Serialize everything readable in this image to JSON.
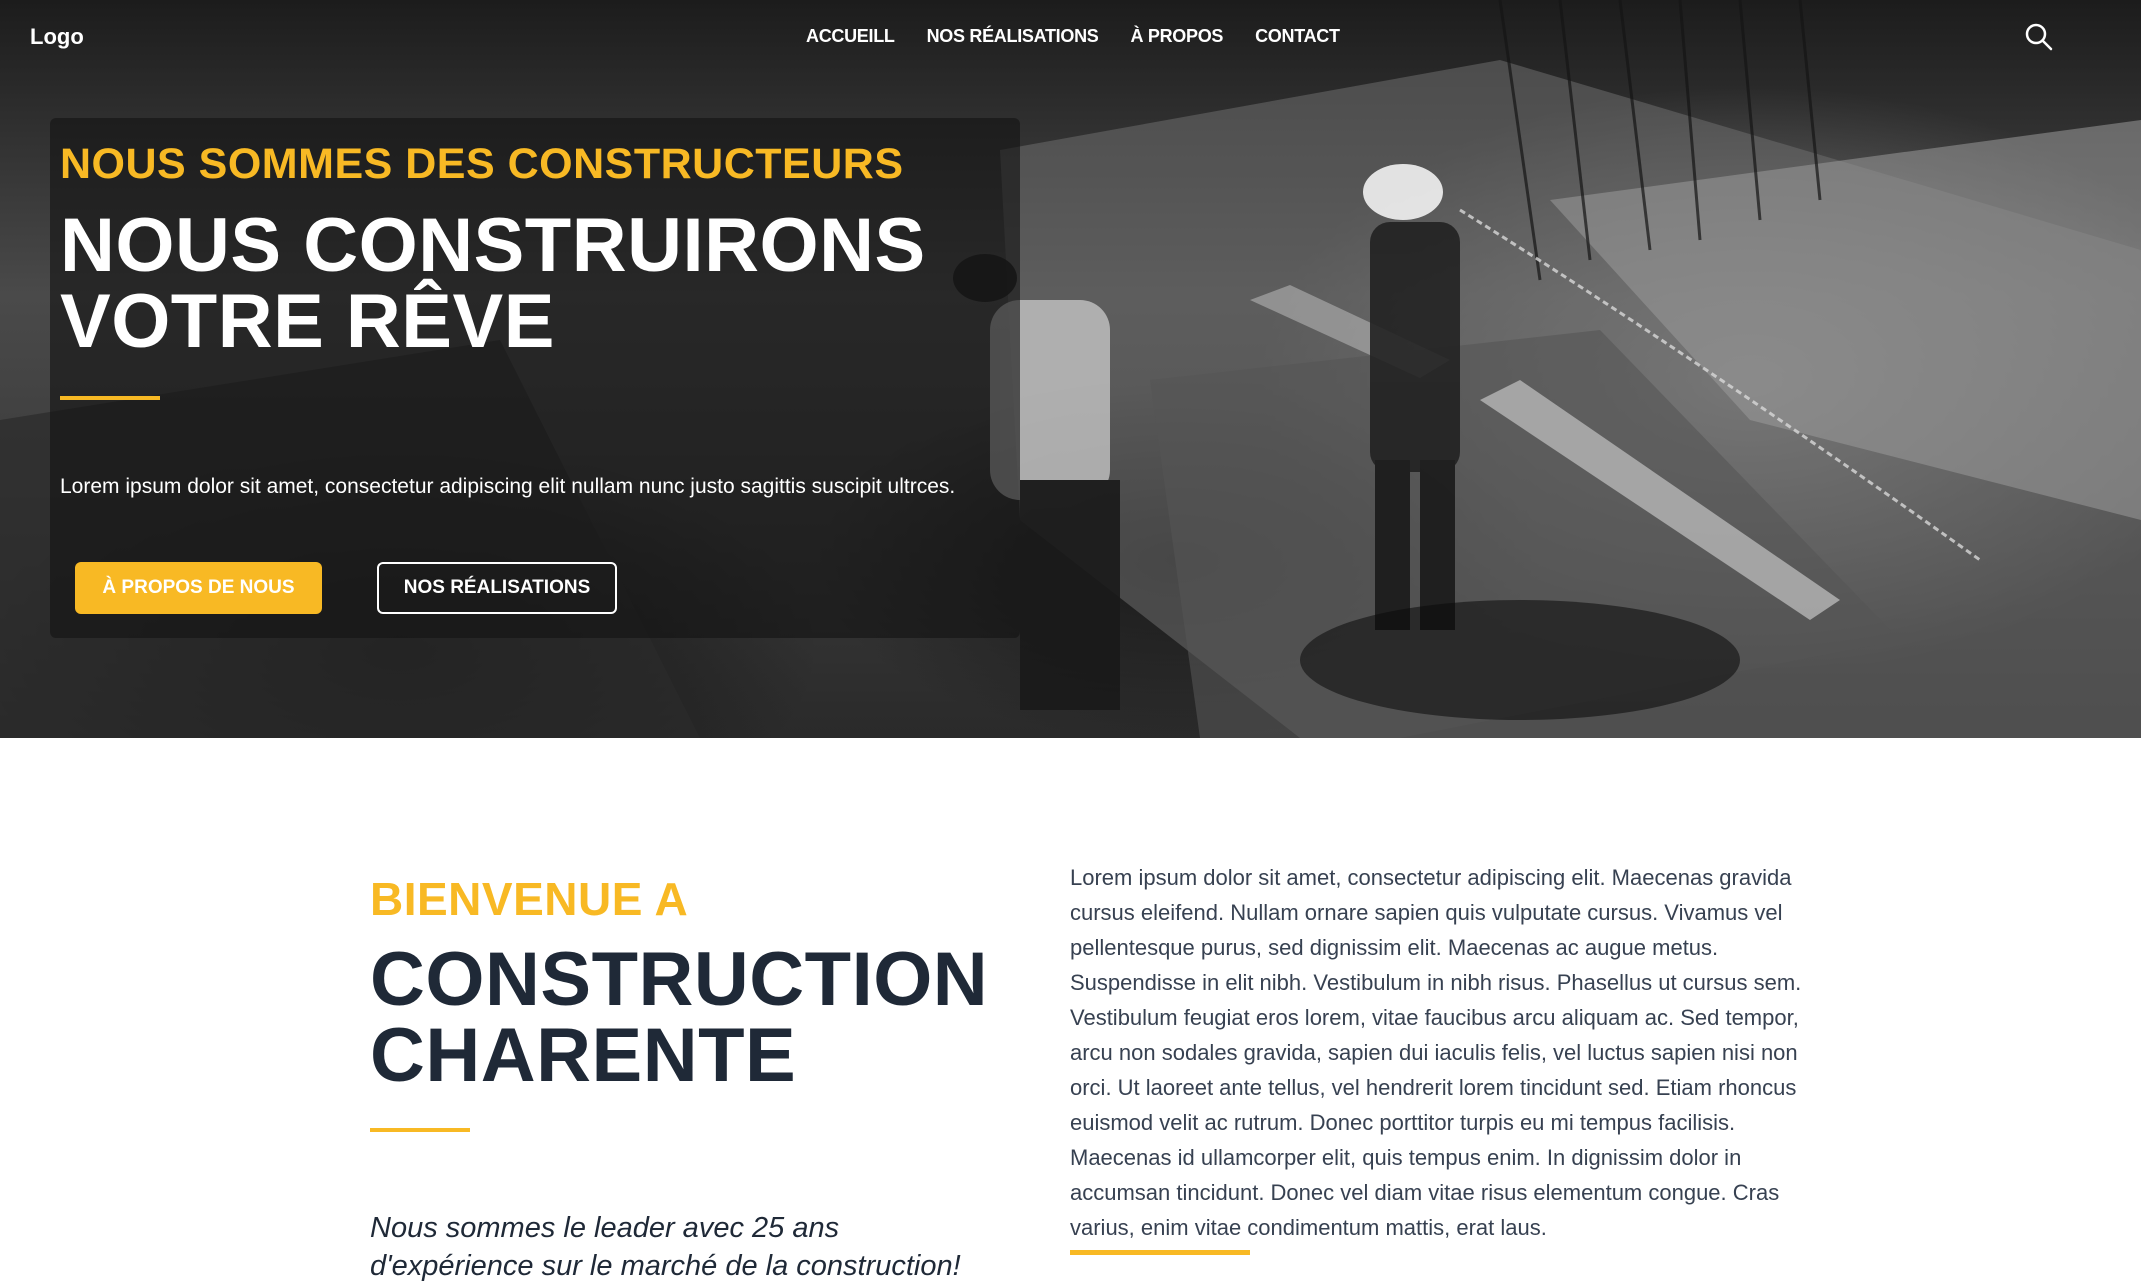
{
  "header": {
    "logo": "Logo",
    "nav": [
      "ACCUEILL",
      "NOS RÉALISATIONS",
      "À PROPOS",
      "CONTACT"
    ],
    "search_icon": "search-icon"
  },
  "hero": {
    "eyebrow": "NOUS SOMMES DES CONSTRUCTEURS",
    "title": "NOUS CONSTRUIRONS VOTRE RÊVE",
    "text": "Lorem ipsum dolor sit amet, consectetur adipiscing elit nullam nunc justo sagittis suscipit ultrces.",
    "primary_button": "À PROPOS DE NOUS",
    "secondary_button": "NOS RÉALISATIONS"
  },
  "about": {
    "eyebrow": "BIENVENUE A",
    "title": "CONSTRUCTION CHARENTE",
    "lead": "Nous sommes le leader avec 25 ans d'expérience sur le marché de la construction!",
    "body": "Lorem ipsum dolor sit amet, consectetur adipiscing elit. Maecenas gravida cursus eleifend. Nullam ornare sapien quis vulputate cursus. Vivamus vel pellentesque purus, sed dignissim elit. Maecenas ac augue metus. Suspendisse in elit nibh. Vestibulum in nibh risus. Phasellus ut cursus sem. Vestibulum feugiat eros lorem, vitae faucibus arcu aliquam ac. Sed tempor, arcu non sodales gravida, sapien dui iaculis felis, vel luctus sapien nisi non orci. Ut laoreet ante tellus, vel hendrerit lorem tincidunt sed. Etiam rhoncus euismod velit ac rutrum. Donec porttitor turpis eu mi tempus facilisis. Maecenas id ullamcorper elit, quis tempus enim. In dignissim dolor in accumsan tincidunt. Donec vel diam vitae risus elementum congue. Cras varius, enim vitae condimentum mattis, erat laus."
  },
  "colors": {
    "accent": "#f8b924",
    "dark": "#1f2937",
    "white": "#ffffff"
  }
}
